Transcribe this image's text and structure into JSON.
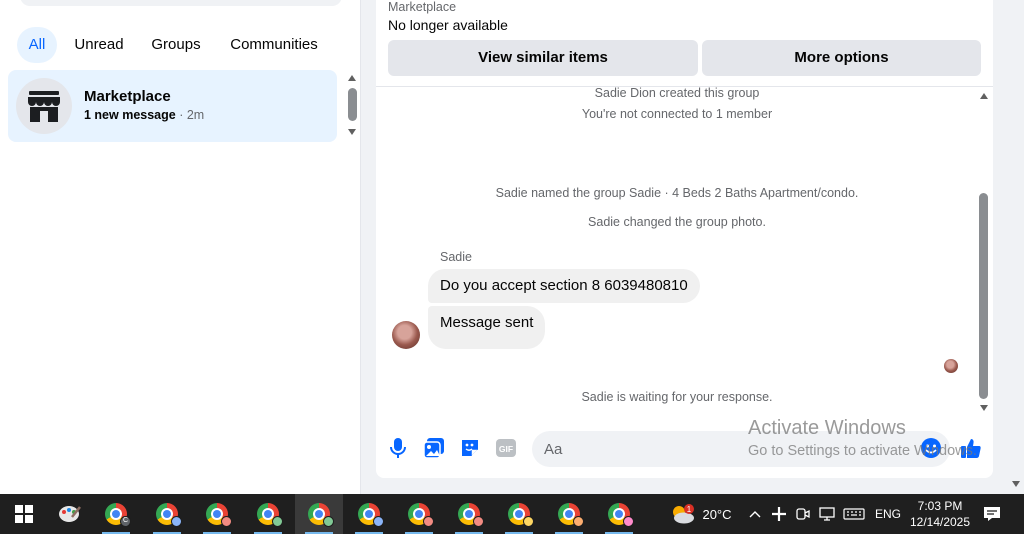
{
  "filters": [
    {
      "label": "All",
      "active": true
    },
    {
      "label": "Unread",
      "active": false
    },
    {
      "label": "Groups",
      "active": false
    },
    {
      "label": "Communities",
      "active": false
    }
  ],
  "chat_list": {
    "name": "Marketplace",
    "preview_bold": "1 new message",
    "separator": " · ",
    "time": "2m"
  },
  "marketplace_banner": {
    "label": "Marketplace",
    "status": "No longer available",
    "view_similar": "View similar items",
    "more_options": "More options"
  },
  "system_messages": {
    "created": "Sadie Dion created this group",
    "not_connected": "You're not connected to 1 member",
    "named": "Sadie named the group Sadie · 4 Beds 2 Baths Apartment/condo.",
    "changed_photo": "Sadie changed the group photo.",
    "waiting": "Sadie is waiting for your response."
  },
  "messages": {
    "sender": "Sadie",
    "first": "Do you accept section 8 6039480810",
    "second": "Message sent"
  },
  "composer": {
    "placeholder": "Aa",
    "icons": [
      "microphone-icon",
      "photo-icon",
      "sticker-icon",
      "gif-icon",
      "emoji-icon",
      "like-icon"
    ],
    "gif_label": "GIF"
  },
  "watermark": {
    "title": "Activate Windows",
    "subtitle": "Go to Settings to activate Windows."
  },
  "taskbar": {
    "temperature": "20°C",
    "language": "ENG",
    "time": "7:03 PM",
    "date": "12/14/2025",
    "weather_badge": "1",
    "chrome_profile_badge": "C"
  },
  "colors": {
    "accent": "#0866ff",
    "active_tab_bg": "#e7f3ff",
    "bubble_bg": "#f0f0f0",
    "taskbar_bg": "#1f1f1f"
  }
}
